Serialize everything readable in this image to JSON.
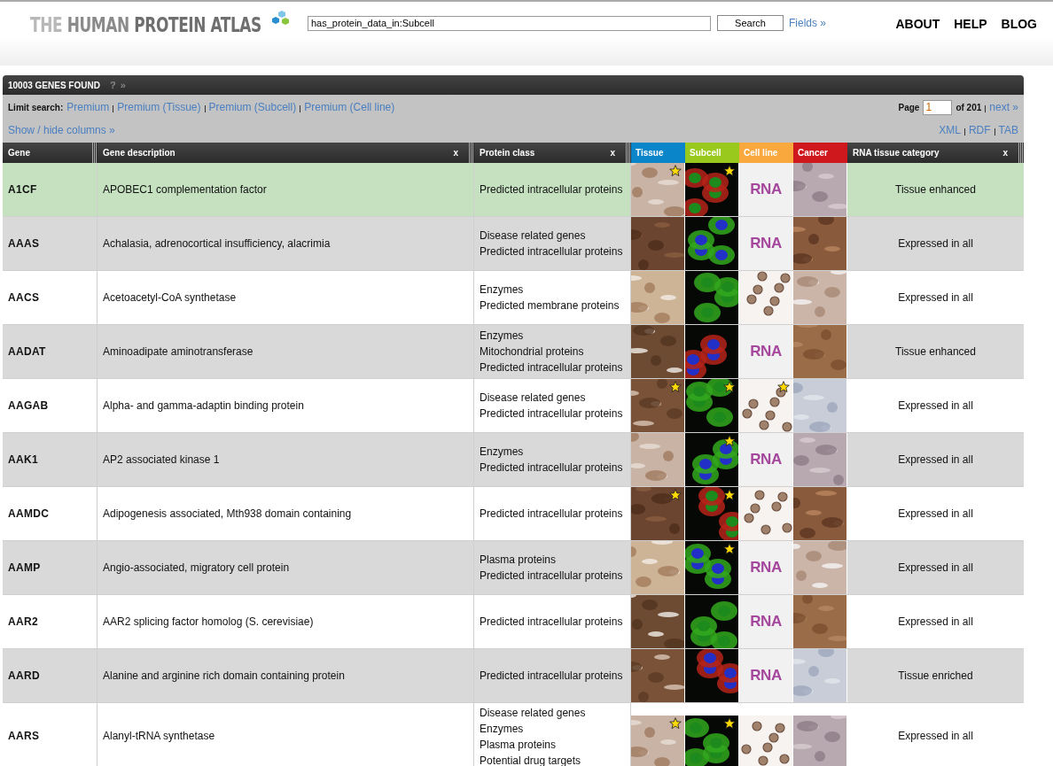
{
  "header": {
    "logo": {
      "words": [
        "THE",
        "HUMAN",
        "PROTEIN",
        "ATLAS"
      ]
    },
    "search": {
      "value": "has_protein_data_in:Subcell",
      "button": "Search",
      "fields_link": "Fields »"
    },
    "nav": [
      "ABOUT",
      "HELP",
      "BLOG"
    ]
  },
  "results": {
    "title": "10003 GENES FOUND",
    "help": "?",
    "more": "»",
    "limit_label": "Limit search:",
    "limit_links": [
      "Premium",
      "Premium (Tissue)",
      "Premium (Subcell)",
      "Premium (Cell line)"
    ],
    "page_label": "Page",
    "page_value": "1",
    "page_of": "of 201",
    "next": "next »",
    "show_hide": "Show / hide columns »",
    "exports": [
      "XML",
      "RDF",
      "TAB"
    ]
  },
  "table": {
    "columns": [
      {
        "label": "Gene",
        "kind": "text"
      },
      {
        "label": "Gene description",
        "kind": "text",
        "close": "x"
      },
      {
        "label": "Protein class",
        "kind": "text",
        "close": "x"
      },
      {
        "label": "Tissue",
        "color": "#0a85c9"
      },
      {
        "label": "Subcell",
        "color": "#98c91c"
      },
      {
        "label": "Cell line",
        "color": "#f8a83c"
      },
      {
        "label": "Cancer",
        "color": "#cf181d"
      },
      {
        "label": "RNA tissue category",
        "kind": "text",
        "close": "x"
      }
    ],
    "rows": [
      {
        "gene": "A1CF",
        "description": "APOBEC1 complementation factor",
        "classes": [
          "Predicted intracellular proteins"
        ],
        "selected": true,
        "images": [
          {
            "kind": "picture",
            "starred": true
          },
          {
            "kind": "picture",
            "starred": true
          },
          {
            "kind": "rna",
            "text": "RNA"
          },
          {
            "kind": "picture",
            "starred": false
          }
        ],
        "category": "Tissue enhanced"
      },
      {
        "gene": "AAAS",
        "description": "Achalasia, adrenocortical insufficiency, alacrimia",
        "classes": [
          "Disease related genes",
          "Predicted intracellular proteins"
        ],
        "selected": false,
        "images": [
          {
            "kind": "picture",
            "starred": false
          },
          {
            "kind": "picture",
            "starred": false
          },
          {
            "kind": "rna",
            "text": "RNA"
          },
          {
            "kind": "picture",
            "starred": false
          }
        ],
        "category": "Expressed in all"
      },
      {
        "gene": "AACS",
        "description": "Acetoacetyl-CoA synthetase",
        "classes": [
          "Enzymes",
          "Predicted membrane proteins"
        ],
        "selected": false,
        "images": [
          {
            "kind": "picture",
            "starred": false
          },
          {
            "kind": "picture",
            "starred": false
          },
          {
            "kind": "picture",
            "starred": false
          },
          {
            "kind": "picture",
            "starred": false
          }
        ],
        "category": "Expressed in all"
      },
      {
        "gene": "AADAT",
        "description": "Aminoadipate aminotransferase",
        "classes": [
          "Enzymes",
          "Mitochondrial proteins",
          "Predicted intracellular proteins"
        ],
        "selected": false,
        "images": [
          {
            "kind": "picture",
            "starred": false
          },
          {
            "kind": "picture",
            "starred": false
          },
          {
            "kind": "rna",
            "text": "RNA"
          },
          {
            "kind": "picture",
            "starred": false
          }
        ],
        "category": "Tissue enhanced"
      },
      {
        "gene": "AAGAB",
        "description": "Alpha- and gamma-adaptin binding protein",
        "classes": [
          "Disease related genes",
          "Predicted intracellular proteins"
        ],
        "selected": false,
        "images": [
          {
            "kind": "picture",
            "starred": true
          },
          {
            "kind": "picture",
            "starred": true
          },
          {
            "kind": "picture",
            "starred": true
          },
          {
            "kind": "picture",
            "starred": false
          }
        ],
        "category": "Expressed in all"
      },
      {
        "gene": "AAK1",
        "description": "AP2 associated kinase 1",
        "classes": [
          "Enzymes",
          "Predicted intracellular proteins"
        ],
        "selected": false,
        "images": [
          {
            "kind": "picture",
            "starred": false
          },
          {
            "kind": "picture",
            "starred": true
          },
          {
            "kind": "rna",
            "text": "RNA"
          },
          {
            "kind": "picture",
            "starred": false
          }
        ],
        "category": "Expressed in all"
      },
      {
        "gene": "AAMDC",
        "description": "Adipogenesis associated, Mth938 domain containing",
        "classes": [
          "Predicted intracellular proteins"
        ],
        "selected": false,
        "images": [
          {
            "kind": "picture",
            "starred": true
          },
          {
            "kind": "picture",
            "starred": true
          },
          {
            "kind": "picture",
            "starred": false
          },
          {
            "kind": "picture",
            "starred": false
          }
        ],
        "category": "Expressed in all"
      },
      {
        "gene": "AAMP",
        "description": "Angio-associated, migratory cell protein",
        "classes": [
          "Plasma proteins",
          "Predicted intracellular proteins"
        ],
        "selected": false,
        "images": [
          {
            "kind": "picture",
            "starred": false
          },
          {
            "kind": "picture",
            "starred": true
          },
          {
            "kind": "rna",
            "text": "RNA"
          },
          {
            "kind": "picture",
            "starred": false
          }
        ],
        "category": "Expressed in all"
      },
      {
        "gene": "AAR2",
        "description": "AAR2 splicing factor homolog (S. cerevisiae)",
        "classes": [
          "Predicted intracellular proteins"
        ],
        "selected": false,
        "images": [
          {
            "kind": "picture",
            "starred": false
          },
          {
            "kind": "picture",
            "starred": false
          },
          {
            "kind": "rna",
            "text": "RNA"
          },
          {
            "kind": "picture",
            "starred": false
          }
        ],
        "category": "Expressed in all"
      },
      {
        "gene": "AARD",
        "description": "Alanine and arginine rich domain containing protein",
        "classes": [
          "Predicted intracellular proteins"
        ],
        "selected": false,
        "images": [
          {
            "kind": "picture",
            "starred": false
          },
          {
            "kind": "picture",
            "starred": false
          },
          {
            "kind": "rna",
            "text": "RNA"
          },
          {
            "kind": "picture",
            "starred": false
          }
        ],
        "category": "Tissue enriched"
      },
      {
        "gene": "AARS",
        "description": "Alanyl-tRNA synthetase",
        "classes": [
          "Disease related genes",
          "Enzymes",
          "Plasma proteins",
          "Potential drug targets"
        ],
        "selected": false,
        "images": [
          {
            "kind": "picture",
            "starred": true
          },
          {
            "kind": "picture",
            "starred": true
          },
          {
            "kind": "picture",
            "starred": false
          },
          {
            "kind": "picture",
            "starred": false
          }
        ],
        "category": "Expressed in all"
      }
    ]
  }
}
